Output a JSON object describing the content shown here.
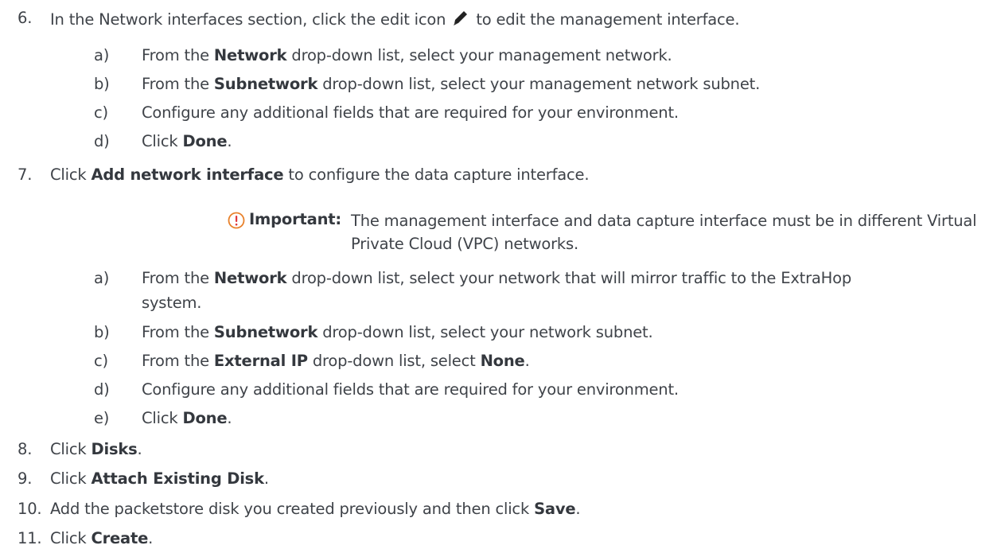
{
  "steps": [
    {
      "number": "6.",
      "parts": [
        "In the Network interfaces section, click the edit icon",
        "to edit the management interface."
      ],
      "icon": "pencil-icon",
      "substeps": [
        {
          "letter": "a)",
          "pre": "From the ",
          "bold": "Network",
          "post": " drop-down list, select your management network."
        },
        {
          "letter": "b)",
          "pre": "From the ",
          "bold": "Subnetwork",
          "post": " drop-down list, select your management network subnet."
        },
        {
          "letter": "c)",
          "text": "Configure any additional fields that are required for your environment."
        },
        {
          "letter": "d)",
          "pre": "Click ",
          "bold": "Done",
          "post": "."
        }
      ]
    },
    {
      "number": "7.",
      "pre": "Click ",
      "bold": "Add network interface",
      "post": " to configure the data capture interface.",
      "note": {
        "icon": "important-icon",
        "label": "Important:",
        "text": "The management interface and data capture interface must be in different Virtual Private Cloud (VPC) networks."
      },
      "substeps": [
        {
          "letter": "a)",
          "pre": "From the ",
          "bold": "Network",
          "post": " drop-down list, select your network that will mirror traffic to the ExtraHop",
          "cont": "system."
        },
        {
          "letter": "b)",
          "pre": "From the ",
          "bold": "Subnetwork",
          "post": " drop-down list, select your network subnet."
        },
        {
          "letter": "c)",
          "pre": "From the ",
          "bold": "External IP",
          "post": " drop-down list, select ",
          "bold2": "None",
          "post2": "."
        },
        {
          "letter": "d)",
          "text": "Configure any additional fields that are required for your environment."
        },
        {
          "letter": "e)",
          "pre": "Click ",
          "bold": "Done",
          "post": "."
        }
      ]
    },
    {
      "number": "8.",
      "pre": "Click ",
      "bold": "Disks",
      "post": "."
    },
    {
      "number": "9.",
      "pre": "Click ",
      "bold": "Attach Existing Disk",
      "post": "."
    },
    {
      "number": "10.",
      "pre": "Add the packetstore disk you created previously and then click ",
      "bold": "Save",
      "post": "."
    },
    {
      "number": "11.",
      "pre": "Click ",
      "bold": "Create",
      "post": "."
    }
  ]
}
